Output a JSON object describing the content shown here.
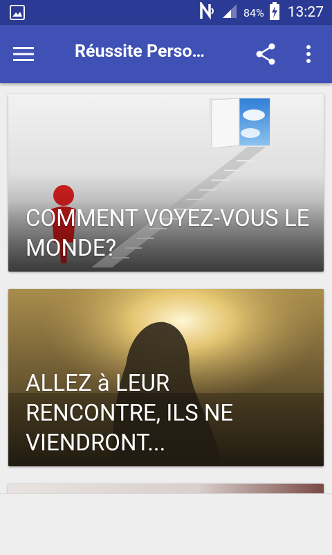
{
  "status_bar": {
    "battery_percent": "84%",
    "time": "13:27",
    "icons": [
      "gallery-icon",
      "nfc-icon",
      "signal-icon",
      "battery-charging-icon"
    ]
  },
  "app_bar": {
    "title": "Réussite Perso…",
    "icons": [
      "hamburger-menu-icon",
      "share-icon",
      "more-vert-icon"
    ],
    "color": "#3f51b5"
  },
  "articles": [
    {
      "title": "COMMENT VOYEZ-VOUS LE MONDE?"
    },
    {
      "title": "ALLEZ à LEUR RENCONTRE, ILS NE VIENDRONT..."
    }
  ],
  "colors": {
    "status_bar": "#2b3a94",
    "app_bar": "#3f51b5",
    "background": "#eeeeee"
  }
}
